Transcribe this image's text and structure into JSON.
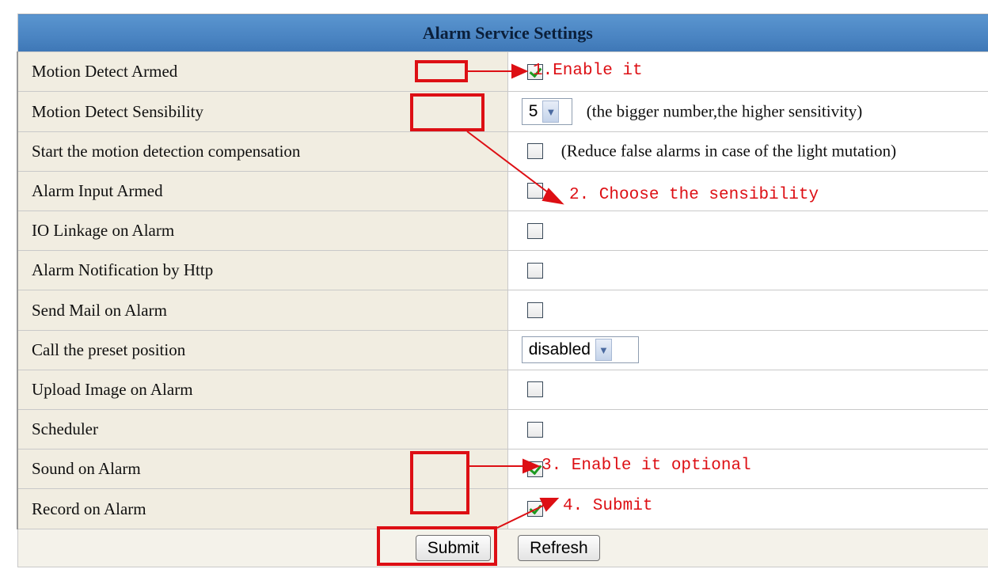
{
  "panel": {
    "title": "Alarm Service Settings"
  },
  "rows": [
    {
      "label": "Motion Detect Armed",
      "checked": true
    },
    {
      "label": "Motion Detect Sensibility",
      "select_value": "5",
      "hint": "(the bigger number,the higher sensitivity)"
    },
    {
      "label": "Start the motion detection compensation",
      "checked": false,
      "hint": "(Reduce false alarms in case of the light mutation)"
    },
    {
      "label": "Alarm Input Armed",
      "checked": false
    },
    {
      "label": "IO Linkage on Alarm",
      "checked": false
    },
    {
      "label": "Alarm Notification by Http",
      "checked": false
    },
    {
      "label": "Send Mail on Alarm",
      "checked": false
    },
    {
      "label": "Call the preset position",
      "select_value": "disabled"
    },
    {
      "label": "Upload Image on Alarm",
      "checked": false
    },
    {
      "label": "Scheduler",
      "checked": false
    },
    {
      "label": "Sound on Alarm",
      "checked": true
    },
    {
      "label": "Record on Alarm",
      "checked": true
    }
  ],
  "buttons": {
    "submit_label": "Submit",
    "refresh_label": "Refresh"
  },
  "annotations": {
    "step1": "1.Enable it",
    "step2": "2. Choose the sensibility",
    "step3": "3. Enable it optional",
    "step4": "4. Submit",
    "color": "#dd0f14"
  },
  "colors": {
    "header_bg": "#4a84c2",
    "label_bg": "#f1ede1",
    "checkmark": "#1c9a20"
  }
}
